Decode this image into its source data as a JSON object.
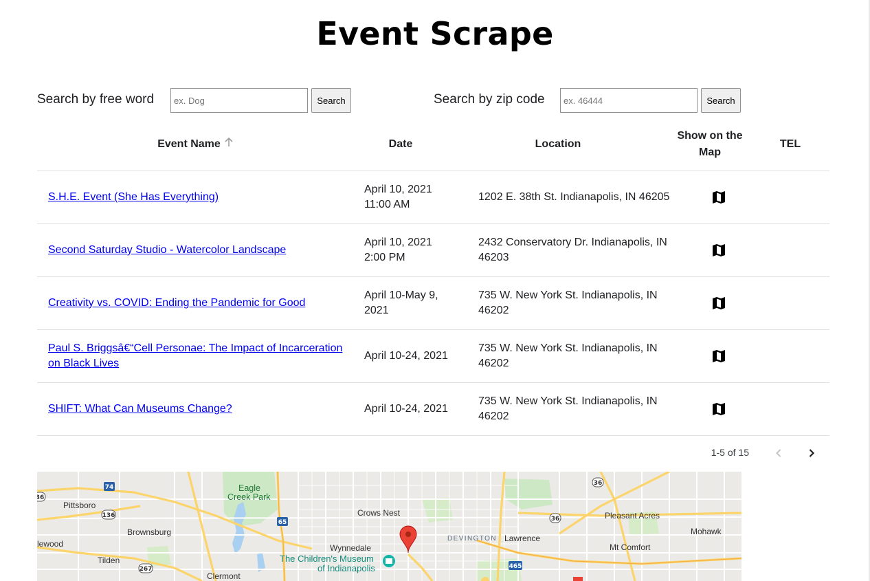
{
  "page": {
    "title": "Event Scrape"
  },
  "search_free": {
    "label": "Search by free word",
    "placeholder": "ex. Dog",
    "value": "",
    "button": "Search"
  },
  "search_zip": {
    "label": "Search by zip code",
    "placeholder": "ex. 46444",
    "value": "",
    "button": "Search"
  },
  "table": {
    "columns": [
      "Event Name",
      "Date",
      "Location",
      "Show on the Map",
      "TEL"
    ],
    "sort_column": "Event Name",
    "sort_icon": "arrow-up-icon",
    "rows": [
      {
        "name": "S.H.E. Event (She Has Everything)",
        "date": "April 10, 2021 11:00 AM",
        "location": "1202 E. 38th St. Indianapolis, IN 46205",
        "map_icon": "map-icon",
        "tel": ""
      },
      {
        "name": "Second Saturday Studio - Watercolor Landscape",
        "date": "April 10, 2021 2:00 PM",
        "location": "2432 Conservatory Dr. Indianapolis, IN 46203",
        "map_icon": "map-icon",
        "tel": ""
      },
      {
        "name": "Creativity vs. COVID: Ending the Pandemic for Good",
        "date": "April 10-May 9, 2021",
        "location": "735 W. New York St. Indianapolis, IN 46202",
        "map_icon": "map-icon",
        "tel": ""
      },
      {
        "name": "Paul S. Briggsâ€“Cell Personae: The Impact of Incarceration on Black Lives",
        "date": "April 10-24, 2021",
        "location": "735 W. New York St. Indianapolis, IN 46202",
        "map_icon": "map-icon",
        "tel": ""
      },
      {
        "name": "SHIFT: What Can Museums Change?",
        "date": "April 10-24, 2021",
        "location": "735 W. New York St. Indianapolis, IN 46202",
        "map_icon": "map-icon",
        "tel": ""
      }
    ]
  },
  "pagination": {
    "range_text": "1-5 of 15",
    "prev_icon": "chevron-left-icon",
    "next_icon": "chevron-right-icon",
    "prev_enabled": false,
    "next_enabled": true
  },
  "map": {
    "labels": {
      "eagle": "Eagle",
      "creek_park": "Creek Park",
      "pittsboro": "Pittsboro",
      "brownsburg": "Brownsburg",
      "lewood": "lewood",
      "tilden": "Tilden",
      "clermont": "Clermont",
      "crows_nest": "Crows Nest",
      "wynnedale": "Wynnedale",
      "museum_1": "The Children's Museum",
      "museum_2": "of Indianapolis",
      "devington": "DEVINGTON",
      "lawrence": "Lawrence",
      "pleasant_acres": "Pleasant Acres",
      "mohawk": "Mohawk",
      "mt_comfort": "Mt Comfort"
    },
    "shields": [
      "74",
      "36",
      "136",
      "65",
      "36",
      "36",
      "267",
      "465"
    ],
    "colors": {
      "land": "#eceae6",
      "highway": "#fbd46c",
      "road": "#ffffff",
      "park": "#cde8c4",
      "water": "#a9d0f0",
      "pin": "#ea4335"
    }
  },
  "colors": {
    "link": "#0000ee",
    "divider": "#e0e0e0"
  }
}
